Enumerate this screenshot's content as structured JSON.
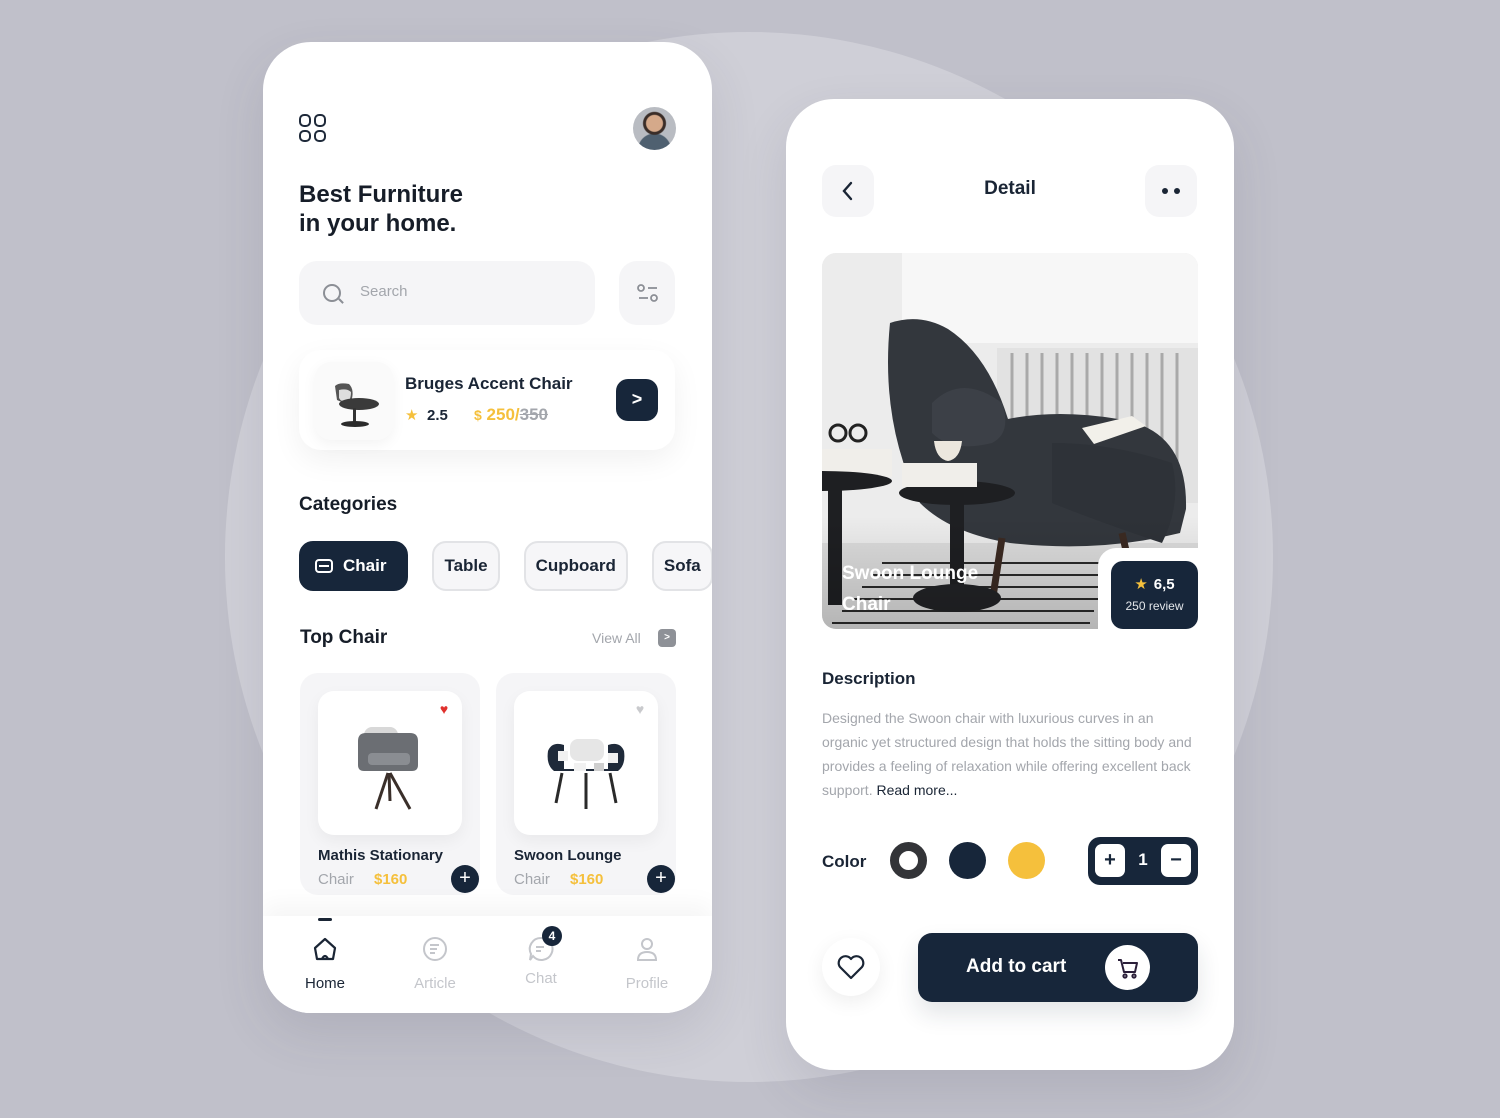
{
  "home": {
    "headline_line1": "Best Furniture",
    "headline_line2": "in your home.",
    "search": {
      "placeholder": "Search"
    },
    "featured": {
      "title": "Bruges Accent Chair",
      "rating": "2.5",
      "currency": "$",
      "price": "250/",
      "old_price": "350"
    },
    "categories_title": "Categories",
    "categories": [
      {
        "label": "Chair",
        "active": true
      },
      {
        "label": "Table",
        "active": false
      },
      {
        "label": "Cupboard",
        "active": false
      },
      {
        "label": "Sofa",
        "active": false
      }
    ],
    "top_section_title": "Top Chair",
    "view_all_label": "View All",
    "products": [
      {
        "name": "Mathis Stationary",
        "category": "Chair",
        "price": "$160",
        "favorited": true
      },
      {
        "name": "Swoon Lounge",
        "category": "Chair",
        "price": "$160",
        "favorited": false
      }
    ],
    "nav": [
      {
        "label": "Home",
        "icon": "home-icon",
        "active": true
      },
      {
        "label": "Article",
        "icon": "article-icon",
        "active": false
      },
      {
        "label": "Chat",
        "icon": "chat-icon",
        "active": false,
        "badge": "4"
      },
      {
        "label": "Profile",
        "icon": "profile-icon",
        "active": false
      }
    ]
  },
  "detail": {
    "title": "Detail",
    "product_name_line1": "Swoon Lounge",
    "product_name_line2": "Chair",
    "rating": "6,5",
    "reviews": "250 review",
    "description_title": "Description",
    "description": "Designed the Swoon chair with luxurious curves in an organic yet structured design that holds the sitting body and provides a feeling of relaxation while offering excellent back support.",
    "read_more": "Read more...",
    "color_label": "Color",
    "colors": [
      "#333438",
      "#17263a",
      "#f5c03c"
    ],
    "selected_color": "#333438",
    "quantity": "1",
    "add_to_cart_label": "Add to cart"
  },
  "theme": {
    "primary": "#17263a",
    "accent": "#f5c03c",
    "favorite": "#e0302c"
  }
}
